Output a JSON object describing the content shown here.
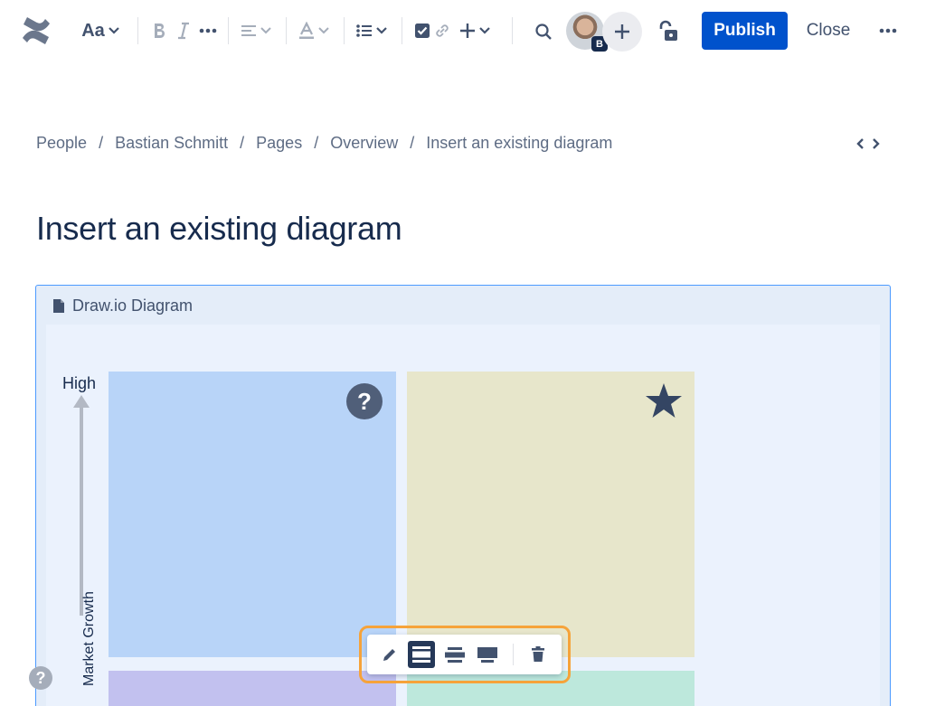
{
  "toolbar": {
    "text_style_label": "Aa",
    "avatar_badge": "B",
    "publish_label": "Publish",
    "close_label": "Close"
  },
  "breadcrumb": {
    "items": [
      "People",
      "Bastian Schmitt",
      "Pages",
      "Overview",
      "Insert an existing diagram"
    ],
    "separator": "/"
  },
  "page": {
    "title": "Insert an existing diagram"
  },
  "macro": {
    "header": "Draw.io Diagram",
    "diagram": {
      "axis_top": "High",
      "axis_label": "Market Growth",
      "quadrant_colors": [
        "#b8d4f8",
        "#e7e6cb",
        "#c2c1ef",
        "#bde8dc"
      ],
      "quadrant_icons": [
        "question-icon",
        "star-icon"
      ]
    }
  },
  "floating_toolbar": {
    "buttons": [
      "edit-icon",
      "layout-center-icon",
      "layout-wide-icon",
      "layout-full-width-icon",
      "delete-icon"
    ],
    "active": "layout-center-icon",
    "accent": "#f6a33a"
  },
  "colors": {
    "primary": "#0052cc",
    "text": "#172b4d",
    "subtle": "#42526e"
  },
  "help": {
    "label": "?"
  }
}
